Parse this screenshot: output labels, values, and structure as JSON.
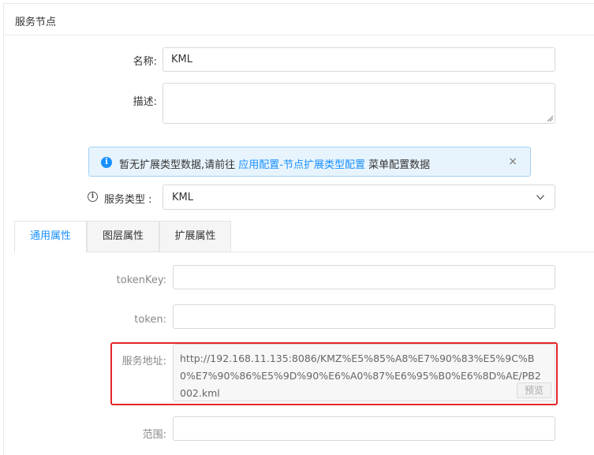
{
  "panel": {
    "title": "服务节点"
  },
  "form": {
    "name_label": "名称:",
    "name_value": "KML",
    "desc_label": "描述:",
    "desc_value": ""
  },
  "alert": {
    "text_before": "暂无扩展类型数据,请前往 ",
    "link_text": "应用配置-节点扩展类型配置",
    "text_after": " 菜单配置数据",
    "close_glyph": "×",
    "info_glyph": "i"
  },
  "service_type": {
    "info_glyph": "i",
    "label": "服务类型 :",
    "value": "KML"
  },
  "tabs": [
    {
      "label": "通用属性",
      "active": true
    },
    {
      "label": "图层属性",
      "active": false
    },
    {
      "label": "扩展属性",
      "active": false
    }
  ],
  "props": {
    "tokenkey_label": "tokenKey:",
    "tokenkey_value": "",
    "token_label": "token:",
    "token_value": "",
    "url_label": "服务地址:",
    "url_value": "http://192.168.11.135:8086/KMZ%E5%85%A8%E7%90%83%E5%9C%B0%E7%90%86%E5%9D%90%E6%A0%87%E6%95%B0%E6%8D%AE/PB2002.kml",
    "preview_label": "预览",
    "range_label": "范围:",
    "range_value": ""
  },
  "colors": {
    "accent": "#1890ff",
    "highlight_border": "#e4262a",
    "alert_bg": "#e8f4fd"
  }
}
